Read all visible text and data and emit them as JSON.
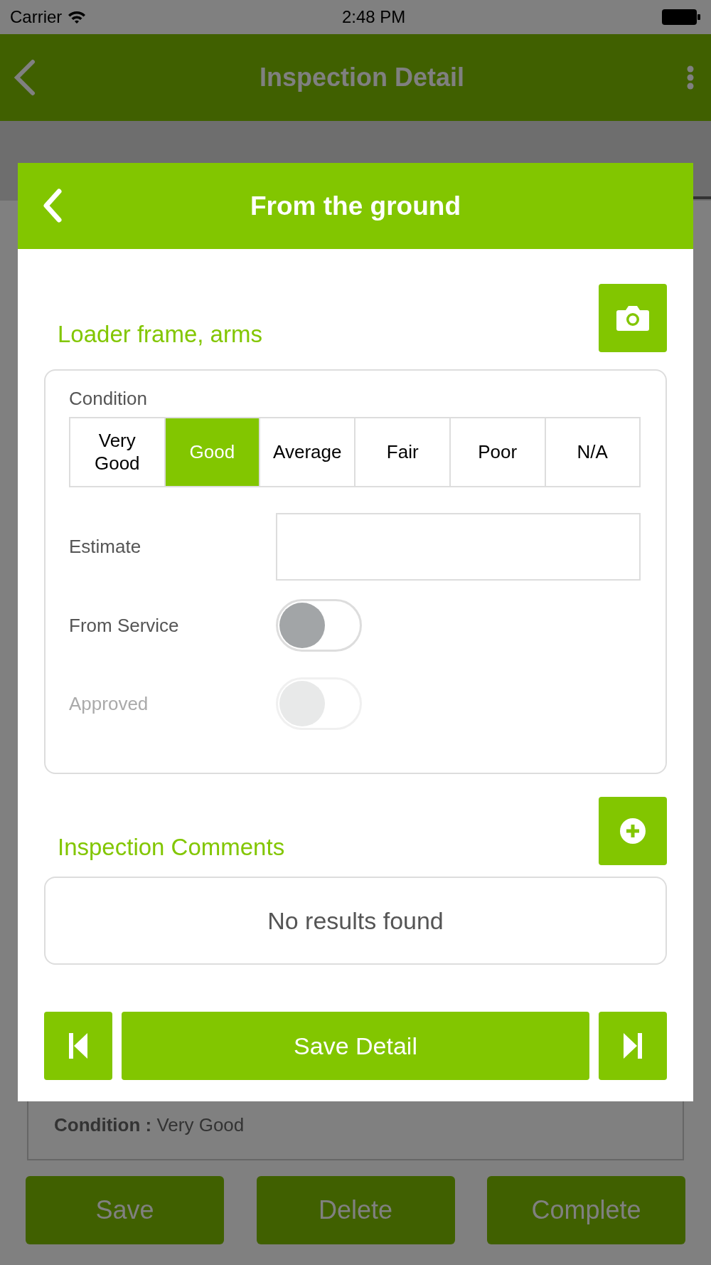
{
  "status_bar": {
    "carrier": "Carrier",
    "time": "2:48 PM"
  },
  "nav": {
    "title": "Inspection Detail"
  },
  "background_card": {
    "label": "Condition :",
    "value": "Very Good"
  },
  "actions": [
    "Save",
    "Delete",
    "Complete"
  ],
  "modal": {
    "title": "From the ground",
    "section_title": "Loader frame, arms",
    "condition": {
      "label": "Condition",
      "options": [
        {
          "label": "Very Good",
          "selected": false
        },
        {
          "label": "Good",
          "selected": true
        },
        {
          "label": "Average",
          "selected": false
        },
        {
          "label": "Fair",
          "selected": false
        },
        {
          "label": "Poor",
          "selected": false
        },
        {
          "label": "N/A",
          "selected": false
        }
      ]
    },
    "estimate": {
      "label": "Estimate"
    },
    "toggles": [
      {
        "label": "From Service",
        "on": false,
        "disabled": false
      },
      {
        "label": "Approved",
        "on": false,
        "disabled": true
      }
    ],
    "comments": {
      "title": "Inspection Comments",
      "empty_text": "No results found"
    },
    "save_label": "Save Detail"
  }
}
